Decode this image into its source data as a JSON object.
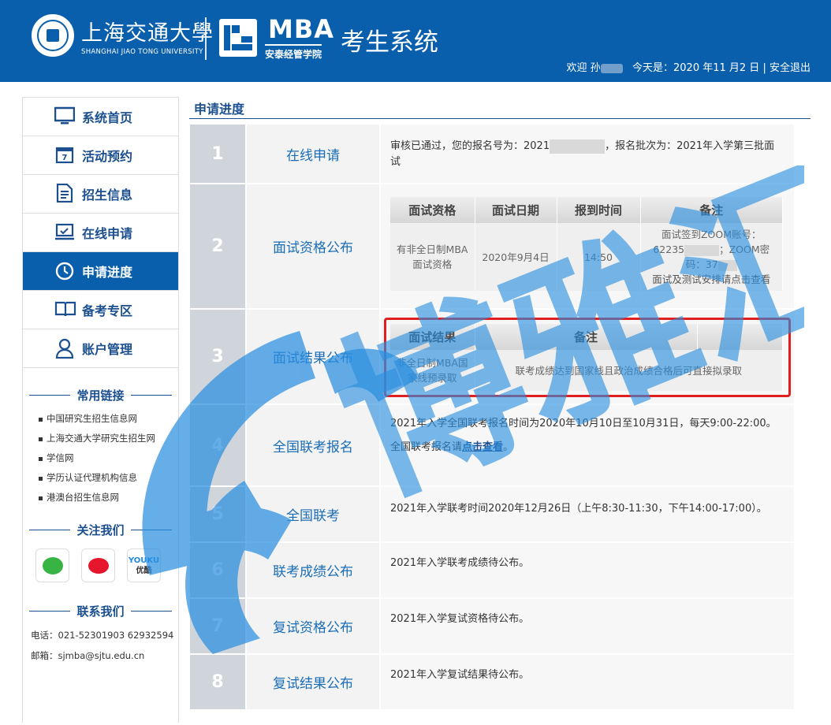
{
  "header": {
    "university_cn": "上海交通大學",
    "university_en": "SHANGHAI JIAO TONG UNIVERSITY",
    "mba": "MBA",
    "mba_sub": "安泰经管学院",
    "system_title": "考生系统",
    "welcome": "欢迎 孙",
    "date_text": "今天是：2020 年11 月2 日",
    "separator": "|",
    "logout": "安全退出"
  },
  "sidebar": {
    "items": [
      {
        "label": "系统首页",
        "icon": "monitor-icon"
      },
      {
        "label": "活动预约",
        "icon": "calendar-icon"
      },
      {
        "label": "招生信息",
        "icon": "document-icon"
      },
      {
        "label": "在线申请",
        "icon": "laptop-icon"
      },
      {
        "label": "申请进度",
        "icon": "clock-icon"
      },
      {
        "label": "备考专区",
        "icon": "book-icon"
      },
      {
        "label": "账户管理",
        "icon": "user-icon"
      }
    ],
    "calendar_day": "7",
    "links_title": "常用链接",
    "links": [
      "中国研究生招生信息网",
      "上海交通大学研究生招生网",
      "学信网",
      "学历认证代理机构信息",
      "港澳台招生信息网"
    ],
    "follow_title": "关注我们",
    "social": {
      "youku_top": "YOUKU",
      "youku_bottom": "优酷"
    },
    "contact_title": "联系我们",
    "phone": "电话：021-52301903 62932594",
    "email": "邮箱：sjmba@sjtu.edu.cn"
  },
  "main": {
    "title": "申请进度",
    "steps": [
      {
        "num": "1",
        "name": "在线申请"
      },
      {
        "num": "2",
        "name": "面试资格公布"
      },
      {
        "num": "3",
        "name": "面试结果公布"
      },
      {
        "num": "4",
        "name": "全国联考报名"
      },
      {
        "num": "5",
        "name": "全国联考"
      },
      {
        "num": "6",
        "name": "联考成绩公布"
      },
      {
        "num": "7",
        "name": "复试资格公布"
      },
      {
        "num": "8",
        "name": "复试结果公布"
      }
    ],
    "step1": {
      "text_a": "审核已通过，您的报名号为：2021",
      "text_b": "，报名批次为：2021年入学第三批面试"
    },
    "step2": {
      "headers": [
        "面试资格",
        "面试日期",
        "报到时间",
        "备注"
      ],
      "qualification": "有非全日制MBA面试资格",
      "date": "2020年9月4日",
      "time": "14:50",
      "note_a": "面试签到ZOOM账号：",
      "note_b": "62235",
      "note_c": "；ZOOM密",
      "note_d": "码：37",
      "note_e": "面试及测试安排请点击查看"
    },
    "step3": {
      "headers": [
        "面试结果",
        "备注"
      ],
      "result": "非全日制MBA国家线预录取",
      "note": "联考成绩达到国家线且政治成绩合格后可直接拟录取"
    },
    "step4": {
      "line1": "2021年入学全国联考报名时间为2020年10月10日至10月31日，每天9:00-22:00。",
      "line2_a": "全国联考报名请",
      "line2_link": "点击查看",
      "line2_b": "。"
    },
    "step5": {
      "text": "2021年入学联考时间2020年12月26日（上午8:30-11:30，下午14:00-17:00）。"
    },
    "step6": {
      "text": "2021年入学联考成绩待公布。"
    },
    "step7": {
      "text": "2021年入学复试资格待公布。"
    },
    "step8": {
      "text": "2021年入学复试结果待公布。"
    }
  },
  "watermark": {
    "text": "博雅汇",
    "color": "#2a8fe0"
  }
}
